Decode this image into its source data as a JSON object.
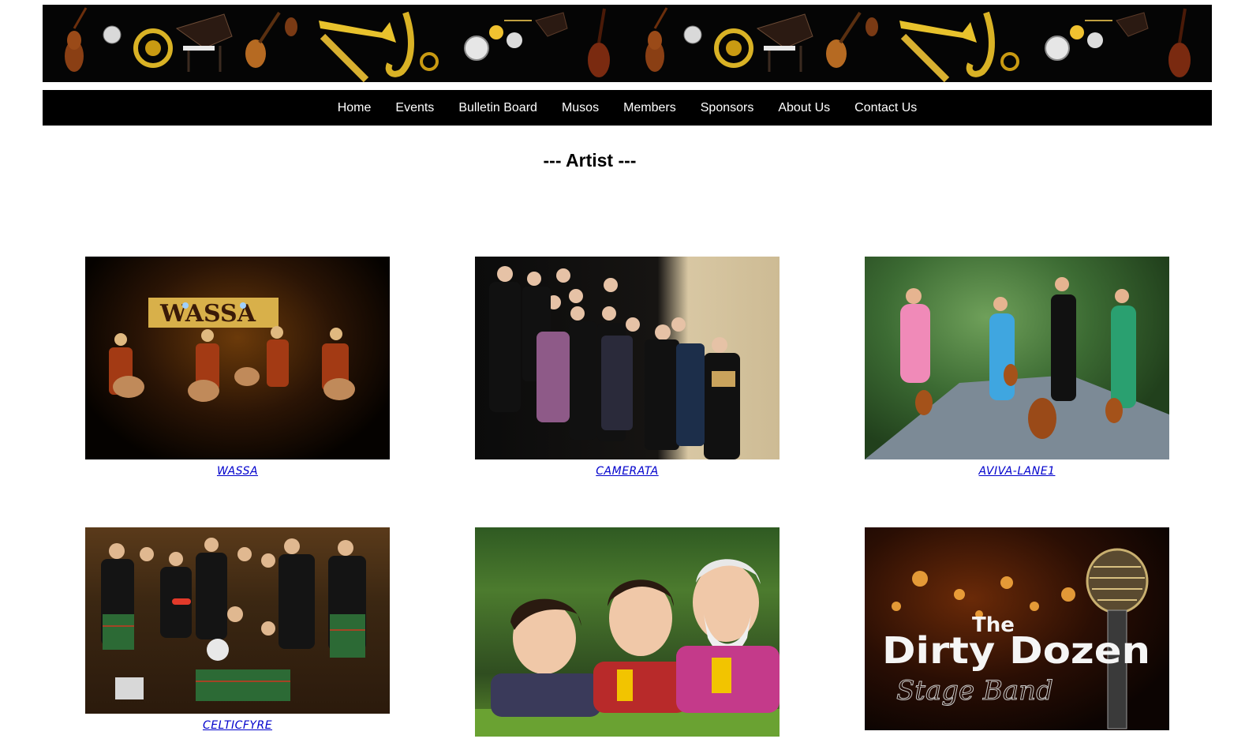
{
  "banner": {
    "alt": "musical instruments banner"
  },
  "nav": {
    "items": [
      {
        "label": "Home"
      },
      {
        "label": "Events"
      },
      {
        "label": "Bulletin Board"
      },
      {
        "label": "Musos"
      },
      {
        "label": "Members"
      },
      {
        "label": "Sponsors"
      },
      {
        "label": "About Us"
      },
      {
        "label": "Contact Us"
      }
    ]
  },
  "page": {
    "title": "--- Artist ---"
  },
  "artists": [
    {
      "name": "WASSA"
    },
    {
      "name": "CAMERATA"
    },
    {
      "name": "AVIVA-LANE1"
    },
    {
      "name": "CELTICFYRE"
    },
    {
      "name": ""
    },
    {
      "name": ""
    }
  ],
  "photo_text": {
    "wassa_sign": "WASSA",
    "dirty_line1": "The",
    "dirty_line2": "Dirty Dozen",
    "dirty_line3": "Stage Band"
  },
  "colors": {
    "nav_bg": "#000000",
    "nav_text": "#ffffff",
    "link": "#0000cc"
  }
}
